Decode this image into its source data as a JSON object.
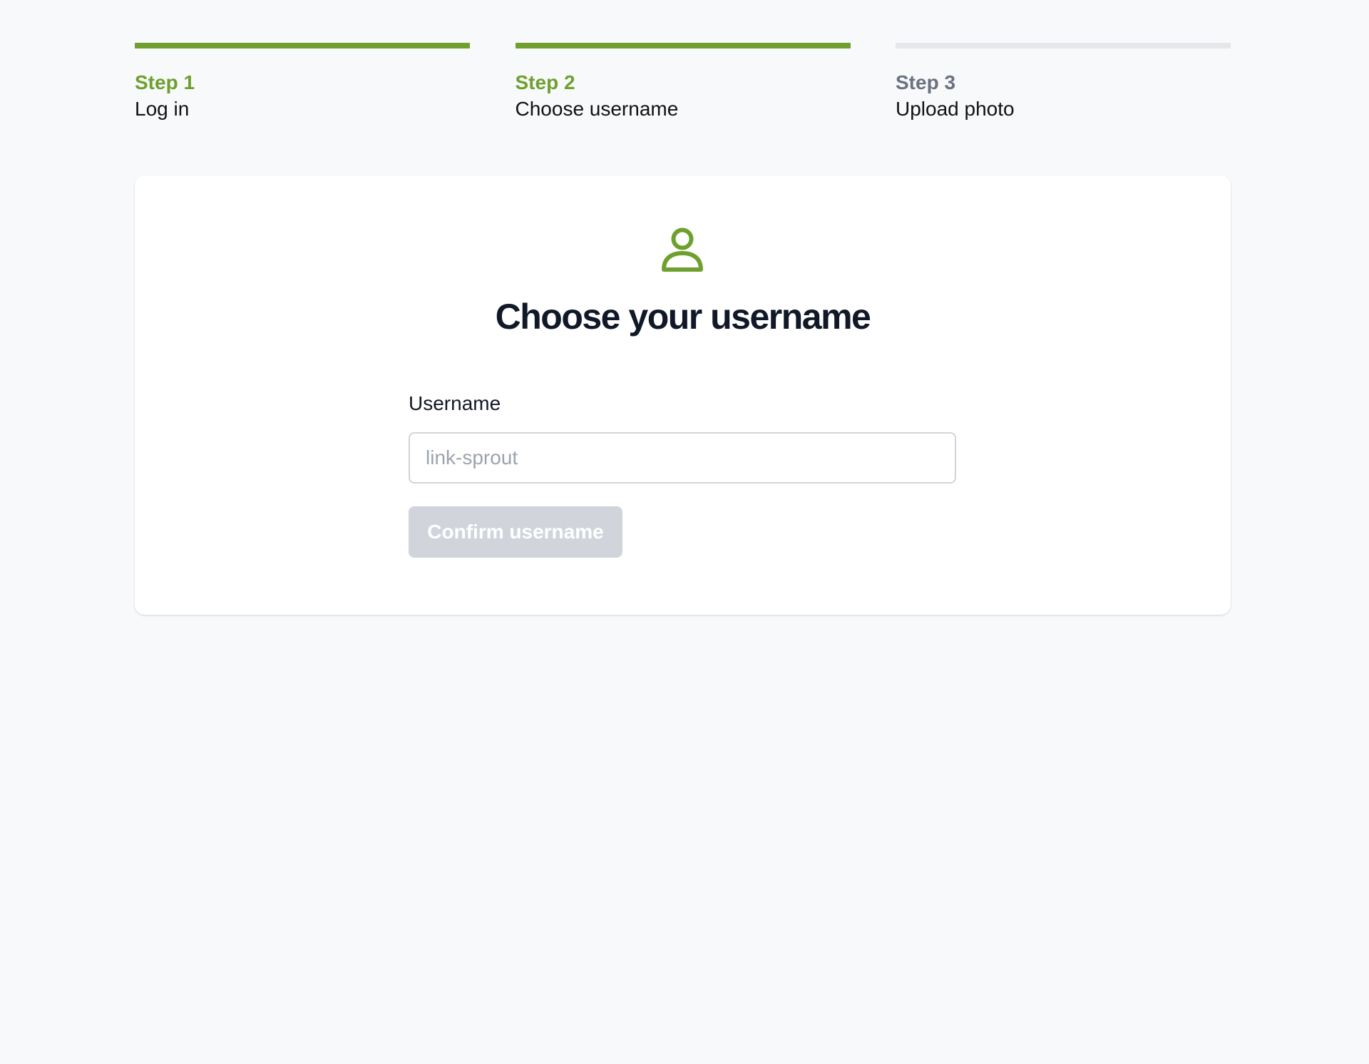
{
  "colors": {
    "accent": "#6fa02f",
    "inactive_bar": "#e5e7eb",
    "inactive_step_text": "#6b7280",
    "disabled_button": "#d1d5db",
    "background": "#f8f9fb"
  },
  "steps": [
    {
      "number": "Step 1",
      "name": "Log in",
      "state": "complete"
    },
    {
      "number": "Step 2",
      "name": "Choose username",
      "state": "current"
    },
    {
      "number": "Step 3",
      "name": "Upload photo",
      "state": "upcoming"
    }
  ],
  "card": {
    "icon": "user-icon",
    "title": "Choose your username",
    "username_label": "Username",
    "username_value": "",
    "username_placeholder": "link-sprout",
    "confirm_label": "Confirm username",
    "confirm_disabled": true
  }
}
